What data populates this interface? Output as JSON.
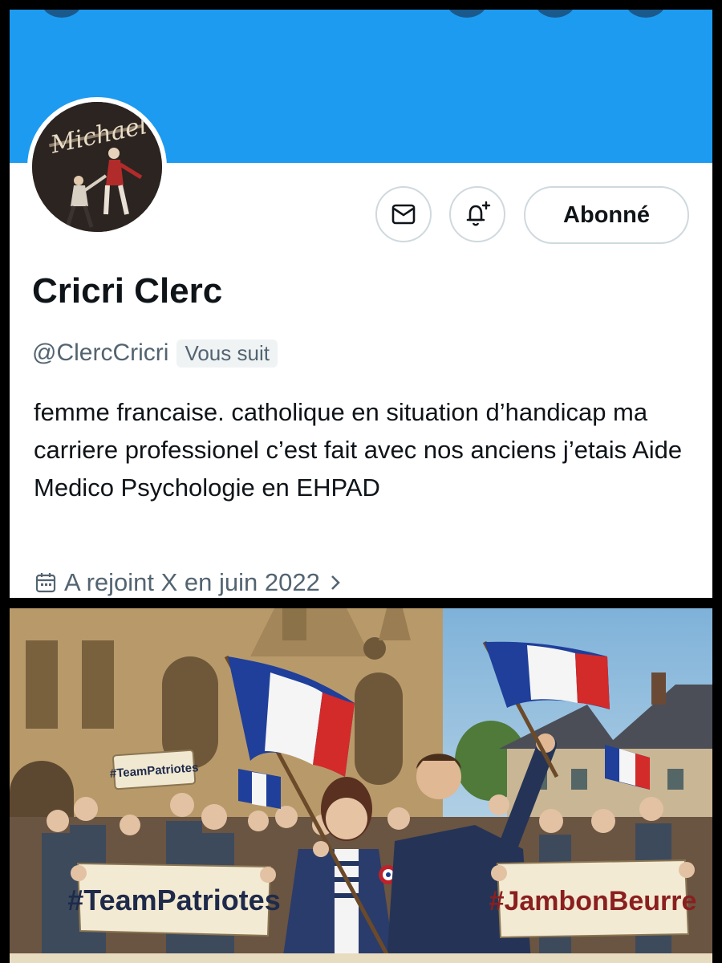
{
  "profile": {
    "avatar_caption": "Michael",
    "name": "Cricri Clerc",
    "handle": "@ClercCricri",
    "follows_you": "Vous suit",
    "follow_button": "Abonné",
    "message_icon": "mail-icon",
    "notify_icon": "bell-plus-icon",
    "bio": "femme francaise. catholique en situation d’handicap ma carriere professionel c’est fait avec nos anciens j’etais Aide Medico Psychologie en EHPAD",
    "joined": "A rejoint X en juin 2022",
    "joined_icon": "calendar-icon",
    "colors": {
      "banner": "#1d9bf0",
      "text": "#0f1419",
      "muted": "#536471"
    }
  },
  "image": {
    "banner_left": "#TeamPatriotes",
    "banner_right": "#JambonBeurre",
    "sign_small": "#TeamPatriotes"
  }
}
